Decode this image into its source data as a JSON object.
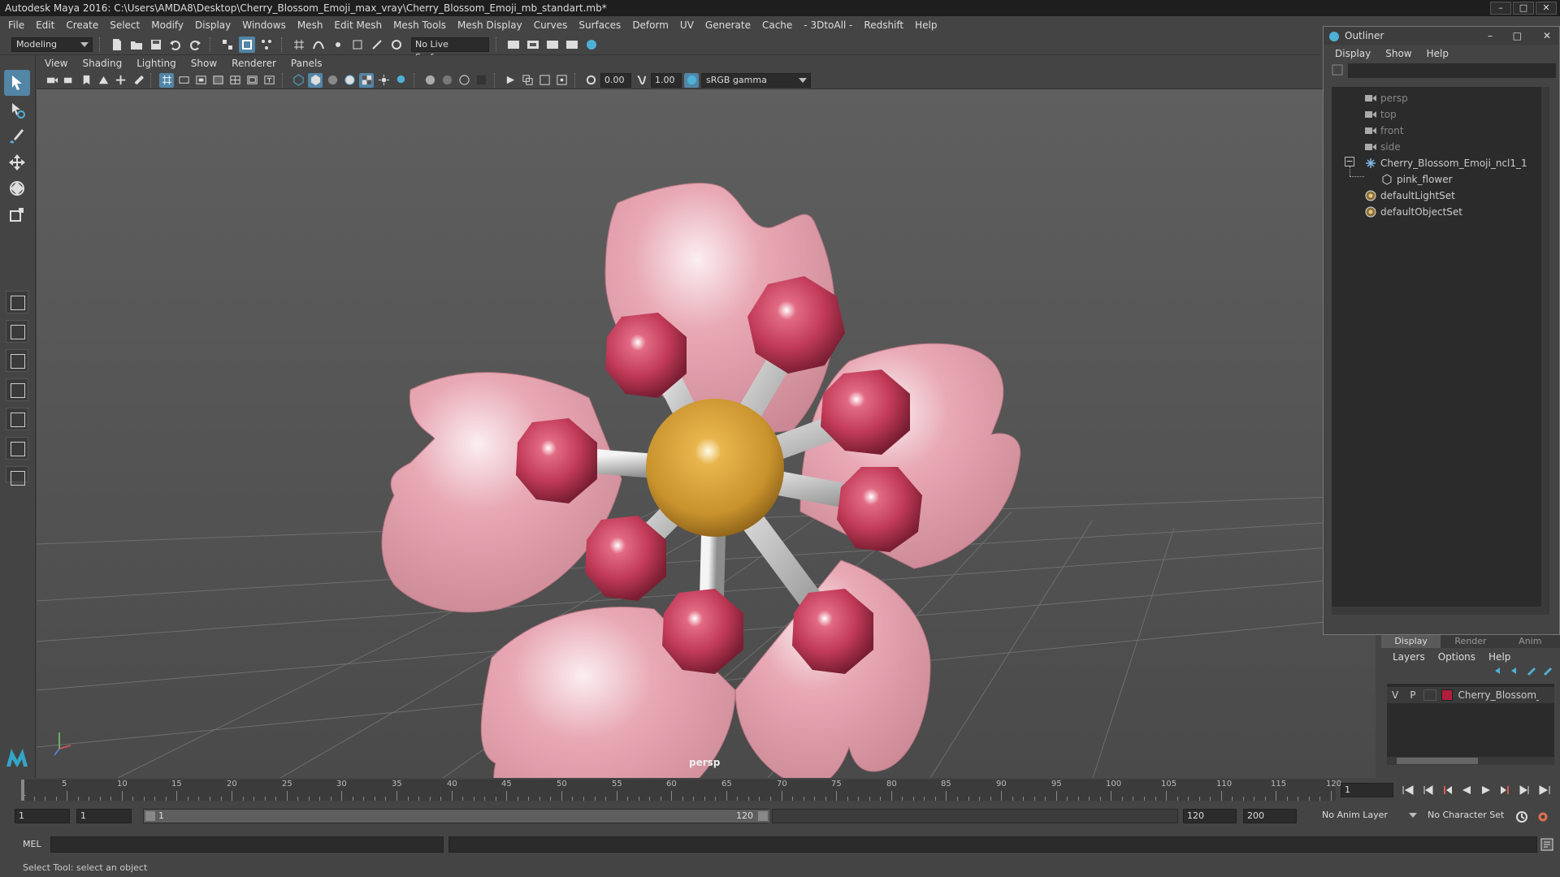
{
  "window": {
    "title": "Autodesk Maya 2016: C:\\Users\\AMDA8\\Desktop\\Cherry_Blossom_Emoji_max_vray\\Cherry_Blossom_Emoji_mb_standart.mb*"
  },
  "menubar": [
    "File",
    "Edit",
    "Create",
    "Select",
    "Modify",
    "Display",
    "Windows",
    "Mesh",
    "Edit Mesh",
    "Mesh Tools",
    "Mesh Display",
    "Curves",
    "Surfaces",
    "Deform",
    "UV",
    "Generate",
    "Cache",
    "- 3DtoAll -",
    "Redshift",
    "Help"
  ],
  "statusline": {
    "mode": "Modeling",
    "live_surface": "No Live Surface"
  },
  "viewport": {
    "menus": [
      "View",
      "Shading",
      "Lighting",
      "Show",
      "Renderer",
      "Panels"
    ],
    "exposure": "0.00",
    "gamma": "1.00",
    "colorspace": "sRGB gamma",
    "camera_label": "persp"
  },
  "outliner": {
    "title": "Outliner",
    "menus": [
      "Display",
      "Show",
      "Help"
    ],
    "items": [
      {
        "label": "persp",
        "icon": "camera-icon",
        "dim": true
      },
      {
        "label": "top",
        "icon": "camera-icon",
        "dim": true
      },
      {
        "label": "front",
        "icon": "camera-icon",
        "dim": true
      },
      {
        "label": "side",
        "icon": "camera-icon",
        "dim": true
      },
      {
        "label": "Cherry_Blossom_Emoji_ncl1_1",
        "icon": "group-icon",
        "dim": false
      },
      {
        "label": "pink_flower",
        "icon": "mesh-icon",
        "dim": false
      },
      {
        "label": "defaultLightSet",
        "icon": "set-icon",
        "dim": false
      },
      {
        "label": "defaultObjectSet",
        "icon": "set-icon",
        "dim": false
      }
    ]
  },
  "layer_editor": {
    "tabs": [
      "Display",
      "Render",
      "Anim"
    ],
    "menus": [
      "Layers",
      "Options",
      "Help"
    ],
    "layer": {
      "v": "V",
      "p": "P",
      "name": "Cherry_Blossom_Emoji",
      "color": "#b01e3c"
    }
  },
  "timeslider": {
    "start": 1,
    "end": 120,
    "current": "1",
    "labels": [
      "5",
      "10",
      "15",
      "20",
      "25",
      "30",
      "35",
      "40",
      "45",
      "50",
      "55",
      "60",
      "65",
      "70",
      "75",
      "80",
      "85",
      "90",
      "95",
      "100",
      "105",
      "110",
      "115",
      "120"
    ],
    "first_label": "1"
  },
  "range": {
    "start_field": "1",
    "anim_start": "1",
    "range_start_label": "1",
    "range_end_label": "120",
    "anim_end": "120",
    "end_field": "200",
    "anim_layer": "No Anim Layer",
    "char_set": "No Character Set"
  },
  "cmdline": {
    "label": "MEL"
  },
  "helpline": {
    "text": "Select Tool: select an object"
  }
}
